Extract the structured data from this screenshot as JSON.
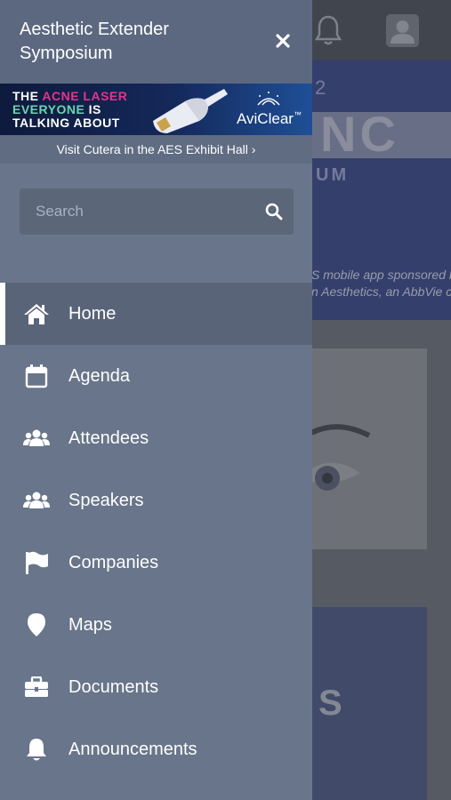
{
  "background_app": {
    "banner_number": "2",
    "banner_big_text": "NC",
    "banner_sub_text": "UM",
    "sponsor_line1": "S mobile app sponsored by",
    "sponsor_line2": "n Aesthetics, an AbbVie comp",
    "card2_text": "S"
  },
  "drawer": {
    "title": "Aesthetic Extender Symposium",
    "ad": {
      "line1_a": "THE ",
      "line1_b": "ACNE LASER",
      "line2_a": "EVERYONE",
      "line2_b": " IS",
      "line3": "TALKING ABOUT",
      "brand": "AviClear",
      "brand_mark": "™"
    },
    "visit_link": "Visit Cutera in the AES Exhibit Hall ›",
    "search": {
      "placeholder": "Search",
      "value": ""
    },
    "nav": [
      {
        "label": "Home",
        "icon": "home-icon",
        "active": true
      },
      {
        "label": "Agenda",
        "icon": "calendar-icon",
        "active": false
      },
      {
        "label": "Attendees",
        "icon": "users-icon",
        "active": false
      },
      {
        "label": "Speakers",
        "icon": "users-icon",
        "active": false
      },
      {
        "label": "Companies",
        "icon": "flag-icon",
        "active": false
      },
      {
        "label": "Maps",
        "icon": "map-marker-icon",
        "active": false
      },
      {
        "label": "Documents",
        "icon": "briefcase-icon",
        "active": false
      },
      {
        "label": "Announcements",
        "icon": "bell-icon",
        "active": false
      }
    ]
  },
  "colors": {
    "drawer_bg": "#68758a",
    "header_bg": "#5c6880",
    "active_item_bg": "#5a6479",
    "text": "#ffffff",
    "ad_pink": "#e5338c",
    "ad_green": "#6ad4b0"
  }
}
